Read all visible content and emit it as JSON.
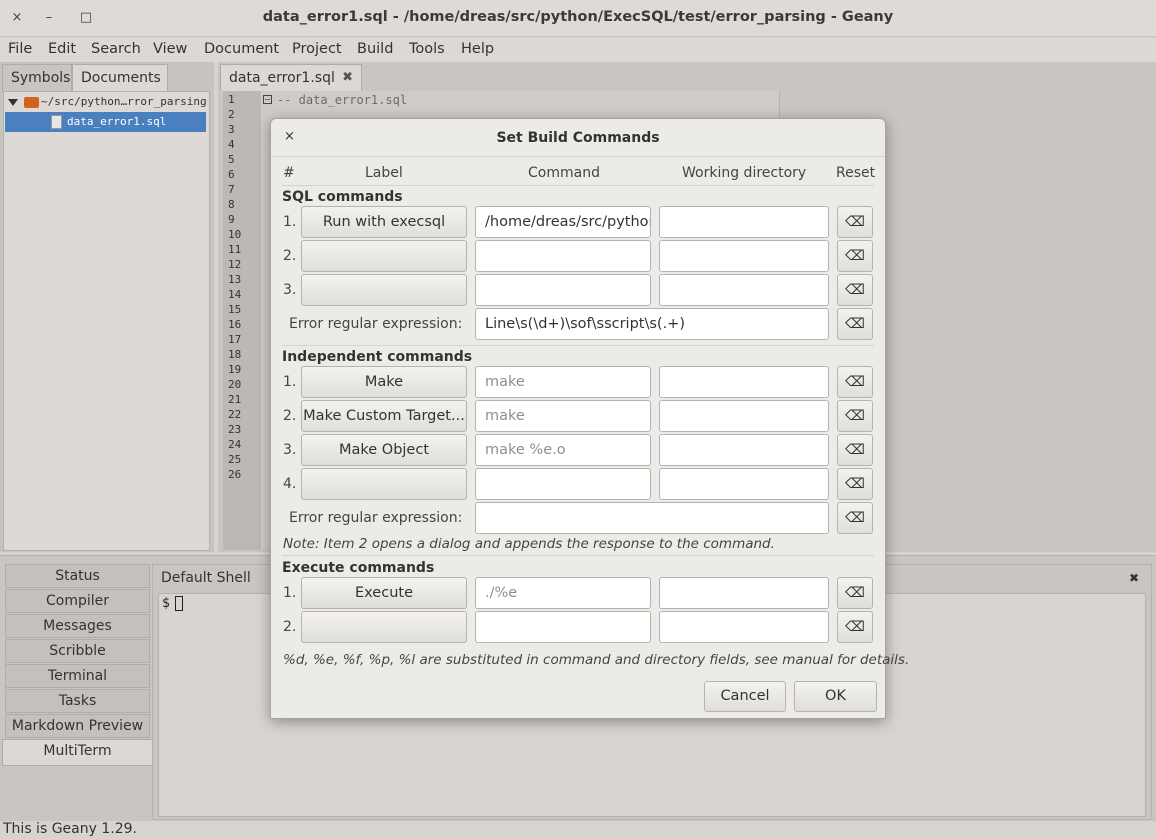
{
  "window": {
    "title": "data_error1.sql - /home/dreas/src/python/ExecSQL/test/error_parsing - Geany",
    "close_glyph": "×",
    "minimize_glyph": "–",
    "maximize_glyph": "□"
  },
  "menu": [
    "File",
    "Edit",
    "Search",
    "View",
    "Document",
    "Project",
    "Build",
    "Tools",
    "Help"
  ],
  "sidebar": {
    "tabs": [
      "Symbols",
      "Documents"
    ],
    "folder": "~/src/python…rror_parsing",
    "file": "data_error1.sql"
  },
  "editor": {
    "tab_label": "data_error1.sql",
    "line_numbers": [
      "1",
      "2",
      "3",
      "4",
      "5",
      "6",
      "7",
      "8",
      "9",
      "10",
      "11",
      "12",
      "13",
      "14",
      "15",
      "16",
      "17",
      "18",
      "19",
      "20",
      "21",
      "22",
      "23",
      "24",
      "25",
      "26"
    ],
    "first_line": "-- data_error1.sql"
  },
  "messages": {
    "tabs": [
      "Status",
      "Compiler",
      "Messages",
      "Scribble",
      "Terminal",
      "Tasks",
      "Markdown Preview",
      "MultiTerm"
    ],
    "shell_label": "Default Shell",
    "prompt": "$"
  },
  "status_bar": "This is Geany 1.29.",
  "dialog": {
    "title": "Set Build Commands",
    "columns": {
      "num": "#",
      "label": "Label",
      "command": "Command",
      "workdir": "Working directory",
      "reset": "Reset"
    },
    "reset_glyph": "⌫",
    "regex_label": "Error regular expression:",
    "sql": {
      "heading": "SQL commands",
      "rows": [
        {
          "num": "1.",
          "label": "Run with execsql",
          "command": "/home/dreas/src/python/ExecSQL/execsql.py",
          "workdir": ""
        },
        {
          "num": "2.",
          "label": "",
          "command": "",
          "workdir": ""
        },
        {
          "num": "3.",
          "label": "",
          "command": "",
          "workdir": ""
        }
      ],
      "regex": "Line\\s(\\d+)\\sof\\sscript\\s(.+)"
    },
    "independent": {
      "heading": "Independent commands",
      "rows": [
        {
          "num": "1.",
          "label": "Make",
          "command": "make",
          "workdir": ""
        },
        {
          "num": "2.",
          "label": "Make Custom Target...",
          "command": "make",
          "workdir": ""
        },
        {
          "num": "3.",
          "label": "Make Object",
          "command": "make %e.o",
          "workdir": ""
        },
        {
          "num": "4.",
          "label": "",
          "command": "",
          "workdir": ""
        }
      ],
      "regex": "",
      "note": "Note: Item 2 opens a dialog and appends the response to the command."
    },
    "execute": {
      "heading": "Execute commands",
      "rows": [
        {
          "num": "1.",
          "label": "Execute",
          "command": "./%e",
          "workdir": ""
        },
        {
          "num": "2.",
          "label": "",
          "command": "",
          "workdir": ""
        }
      ]
    },
    "footer_note": "%d, %e, %f, %p, %l are substituted in command and directory fields, see manual for details.",
    "cancel": "Cancel",
    "ok": "OK"
  }
}
